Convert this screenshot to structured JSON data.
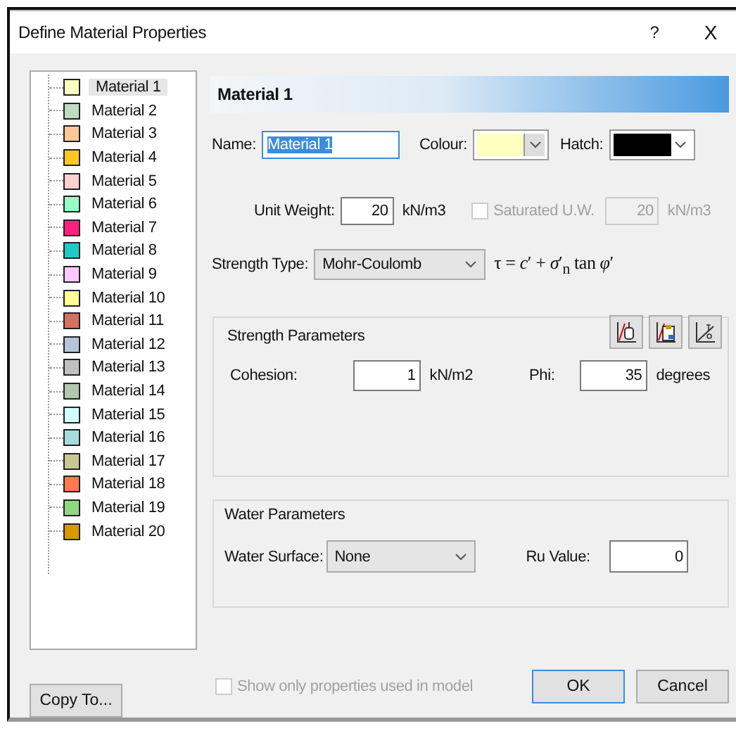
{
  "window": {
    "title": "Define Material Properties",
    "help": "?",
    "close": "X"
  },
  "materials": [
    {
      "label": "Material 1",
      "color": "#ffffc0",
      "selected": true
    },
    {
      "label": "Material 2",
      "color": "#c0dcc0",
      "selected": false
    },
    {
      "label": "Material 3",
      "color": "#ffc896",
      "selected": false
    },
    {
      "label": "Material 4",
      "color": "#ffc820",
      "selected": false
    },
    {
      "label": "Material 5",
      "color": "#ffd0d0",
      "selected": false
    },
    {
      "label": "Material 6",
      "color": "#96ffc8",
      "selected": false
    },
    {
      "label": "Material 7",
      "color": "#ff2080",
      "selected": false
    },
    {
      "label": "Material 8",
      "color": "#20c8c8",
      "selected": false
    },
    {
      "label": "Material 9",
      "color": "#ffc8ff",
      "selected": false
    },
    {
      "label": "Material 10",
      "color": "#ffff96",
      "selected": false
    },
    {
      "label": "Material 11",
      "color": "#d87060",
      "selected": false
    },
    {
      "label": "Material 12",
      "color": "#b8c4d8",
      "selected": false
    },
    {
      "label": "Material 13",
      "color": "#c0c0c0",
      "selected": false
    },
    {
      "label": "Material 14",
      "color": "#b0c8b0",
      "selected": false
    },
    {
      "label": "Material 15",
      "color": "#d0ffff",
      "selected": false
    },
    {
      "label": "Material 16",
      "color": "#a8dcdc",
      "selected": false
    },
    {
      "label": "Material 17",
      "color": "#c8c890",
      "selected": false
    },
    {
      "label": "Material 18",
      "color": "#ff7850",
      "selected": false
    },
    {
      "label": "Material 19",
      "color": "#90d880",
      "selected": false
    },
    {
      "label": "Material 20",
      "color": "#d89800",
      "selected": false
    }
  ],
  "copy_button": "Copy To...",
  "header": "Material 1",
  "name": {
    "label": "Name:",
    "value": "Material 1"
  },
  "colour": {
    "label": "Colour:",
    "color": "#ffffc0"
  },
  "hatch": {
    "label": "Hatch:",
    "color": "#000000"
  },
  "unit_weight": {
    "label": "Unit Weight:",
    "value": "20",
    "unit": "kN/m3"
  },
  "saturated": {
    "label": "Saturated U.W.",
    "checked": false,
    "disabled": true,
    "value": "20",
    "unit": "kN/m3"
  },
  "strength_type": {
    "label": "Strength Type:",
    "value": "Mohr-Coulomb",
    "formula": "τ = *c*′ + *σ*′$_{n}$ tan *φ*′"
  },
  "strength_parameters": {
    "title": "Strength Parameters",
    "fields": [
      {
        "label": "Cohesion:",
        "value": "1",
        "unit": "kN/m2"
      },
      {
        "label": "Phi:",
        "value": "35",
        "unit": "degrees"
      }
    ]
  },
  "water_parameters": {
    "title": "Water Parameters",
    "surface_label": "Water Surface:",
    "surface_value": "None",
    "ru_label": "Ru Value:",
    "ru_value": "0"
  },
  "show_only": {
    "label": "Show only properties used in model",
    "checked": false,
    "disabled": true
  },
  "buttons": [
    "OK",
    "Cancel"
  ]
}
